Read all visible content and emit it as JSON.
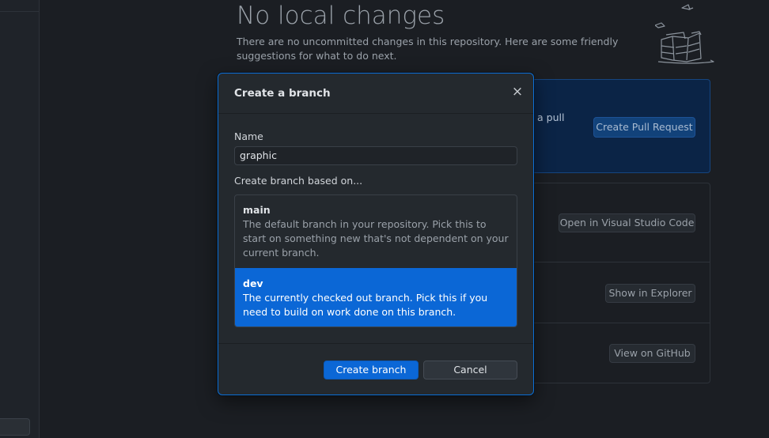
{
  "page": {
    "title": "No local changes",
    "subtitle": "There are no uncommitted changes in this repository. Here are some friendly suggestions for what to do next."
  },
  "suggestions": {
    "pull_request_text_fragment": "a pull",
    "create_pull_request_label": "Create Pull Request",
    "open_editor_label": "Open in Visual Studio Code",
    "show_explorer_label": "Show in Explorer",
    "view_github_label": "View on GitHub"
  },
  "modal": {
    "title": "Create a branch",
    "close_symbol": "×",
    "name_label": "Name",
    "name_value": "graphic",
    "based_on_label": "Create branch based on...",
    "branches": [
      {
        "name": "main",
        "description": "The default branch in your repository. Pick this to start on something new that's not dependent on your current branch."
      },
      {
        "name": "dev",
        "description": "The currently checked out branch. Pick this if you need to build on work done on this branch."
      }
    ],
    "selected_branch": "dev",
    "create_label": "Create branch",
    "cancel_label": "Cancel"
  },
  "colors": {
    "accent": "#0b67d6",
    "modal_border": "#0b6fd8",
    "background": "#1b1e23"
  }
}
